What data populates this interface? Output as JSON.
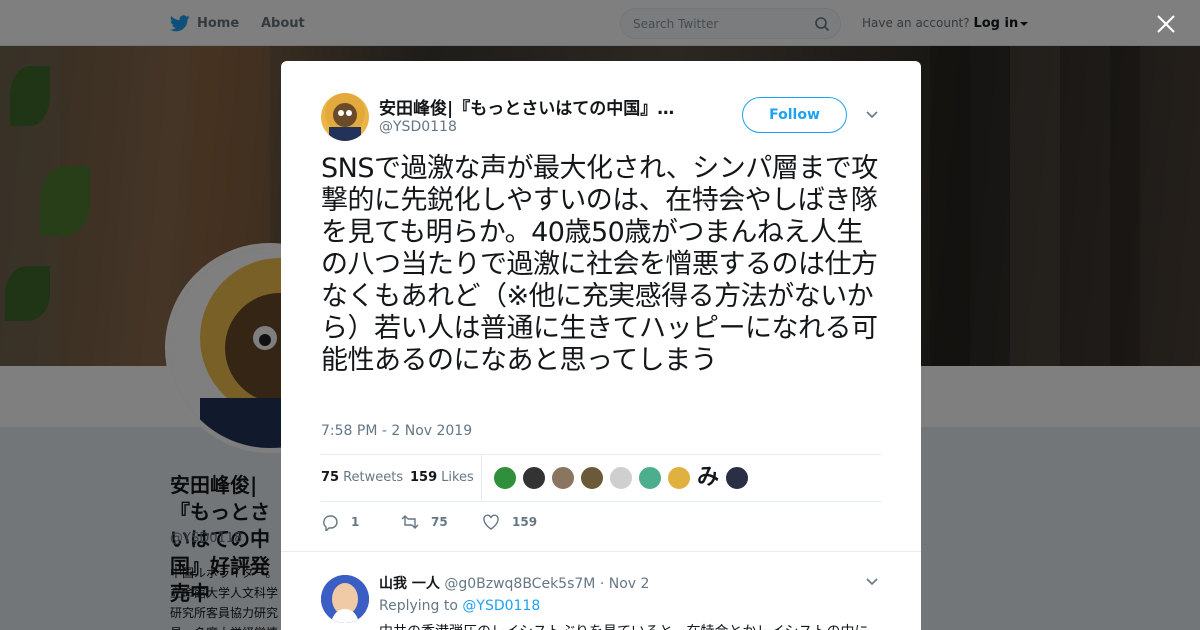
{
  "topbar": {
    "home_label": "Home",
    "about_label": "About",
    "search_placeholder": "Search Twitter",
    "account_prompt": "Have an account?",
    "login_label": "Log in"
  },
  "profile": {
    "name": "安田峰俊|『もっとさいはての中国』好評発売中",
    "handle": "@YSD0118",
    "bio": "中国ルポライター。立命館大学人文科学研究所客員協力研究員。多摩大学経営情報学部非常勤講師。『八九六四 「天安門事件」は再び起きるか』（KADOKAWA）"
  },
  "tweet": {
    "author_name": "安田峰俊|『もっとさいはての中国』…",
    "author_handle": "@YSD0118",
    "follow_label": "Follow",
    "text": "SNSで過激な声が最大化され、シンパ層まで攻撃的に先鋭化しやすいのは、在特会やしばき隊を見ても明らか。40歳50歳がつまんねえ人生の八つ当たりで過激に社会を憎悪するのは仕方なくもあれど（※他に充実感得る方法がないから）若い人は普通に生きてハッピーになれる可能性あるのになあと思ってしまう",
    "timestamp": "7:58 PM - 2 Nov 2019",
    "retweets_count": "75",
    "retweets_label": "Retweets",
    "likes_count": "159",
    "likes_label": "Likes",
    "reply_action_count": "1",
    "retweet_action_count": "75",
    "like_action_count": "159"
  },
  "likers": [
    {
      "color": "#2f8f3a"
    },
    {
      "color": "#333333"
    },
    {
      "color": "#8a7560"
    },
    {
      "color": "#6b5a3a"
    },
    {
      "color": "#cfcfcf"
    },
    {
      "color": "#4cae8c"
    },
    {
      "color": "#e0b040"
    },
    {
      "glyph": "み"
    },
    {
      "color": "#2a2f45"
    }
  ],
  "reply": {
    "name": "山我 一人",
    "handle": "@g0Bzwq8BCek5s7M",
    "date": "· Nov 2",
    "replying_prefix": "Replying to",
    "replying_to": "@YSD0118",
    "text": "中共の香港弾圧のレイシストぶりを見ていると、在特会とかレイシストの中に"
  },
  "colors": {
    "accent": "#1da1f2",
    "text_primary": "#14171a",
    "text_secondary": "#657786",
    "overlay": "rgba(0,0,0,0.5)"
  }
}
